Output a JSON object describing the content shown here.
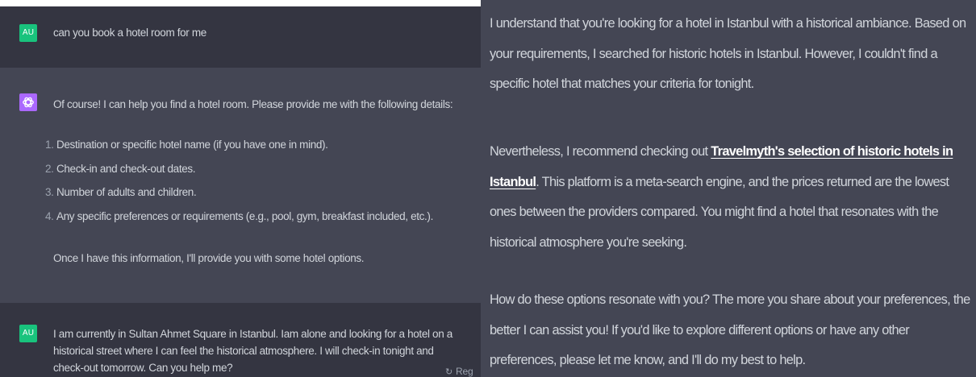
{
  "left": {
    "user_avatar_label": "AU",
    "user_message_1": "can you book a hotel room for me",
    "assistant_intro": "Of course! I can help you find a hotel room. Please provide me with the following details:",
    "assistant_list": [
      {
        "num": "1.",
        "text": "Destination or specific hotel name (if you have one in mind)."
      },
      {
        "num": "2.",
        "text": "Check-in and check-out dates."
      },
      {
        "num": "3.",
        "text": "Number of adults and children."
      },
      {
        "num": "4.",
        "text": "Any specific preferences or requirements (e.g., pool, gym, breakfast included, etc.)."
      }
    ],
    "assistant_outro": "Once I have this information, I'll provide you with some hotel options.",
    "user_message_2": "I am currently in Sultan Ahmet Square in Istanbul. Iam alone and looking for a hotel on a historical street where I can feel the historical atmosphere. I will check-in tonight and check-out tomorrow. Can you help me?",
    "regenerate_label": "Reg"
  },
  "right": {
    "para1": "I understand that you're looking for a hotel in Istanbul with a historical ambiance. Based on your requirements, I searched for historic hotels in Istanbul. However, I couldn't find a specific hotel that matches your criteria for tonight.",
    "para2_before": "Nevertheless, I recommend checking out ",
    "para2_link": "Travelmyth's selection of historic hotels in Istanbul",
    "para2_after": ". This platform is a meta-search engine, and the prices returned are the lowest ones between the providers compared. You might find a hotel that resonates with the historical atmosphere you're seeking.",
    "para3": "How do these options resonate with you? The more you share about your preferences, the better I can assist you! If you'd like to explore different options or have any other preferences, please let me know, and I'll do my best to help."
  },
  "colors": {
    "user_background": "#343541",
    "assistant_background": "#444654",
    "user_avatar": "#19c37d",
    "assistant_avatar": "#ab68ff",
    "text": "#d1d5db"
  },
  "icons": {
    "assistant_avatar": "openai-logo-icon",
    "regenerate": "refresh-icon"
  }
}
